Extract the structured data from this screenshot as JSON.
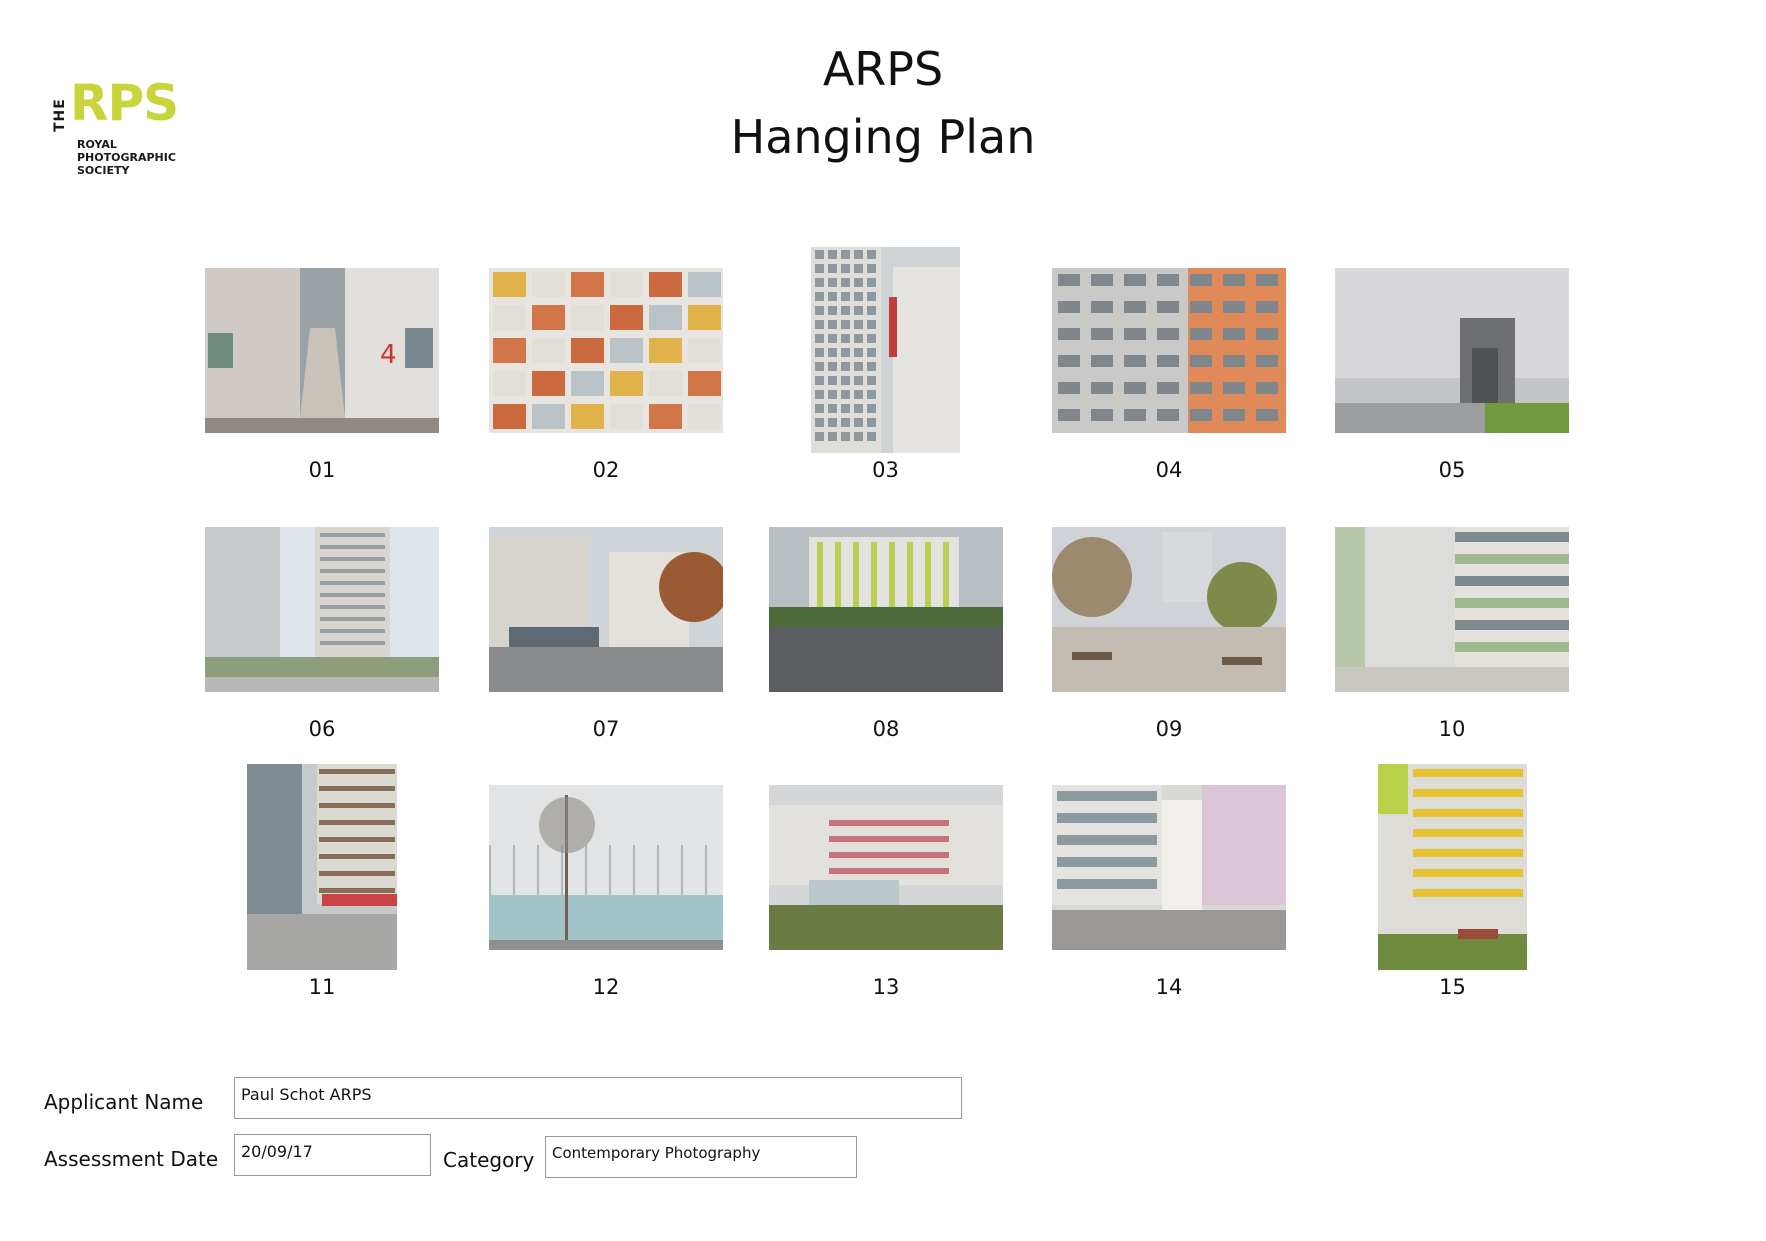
{
  "logo": {
    "the": "THE",
    "rps": "RPS",
    "line1": "ROYAL",
    "line2": "PHOTOGRAPHIC",
    "line3": "SOCIETY",
    "color": "#c8d43a"
  },
  "title": {
    "line1": "ARPS",
    "line2": "Hanging Plan"
  },
  "photos": [
    {
      "label": "01",
      "orientation": "landscape"
    },
    {
      "label": "02",
      "orientation": "landscape"
    },
    {
      "label": "03",
      "orientation": "portrait"
    },
    {
      "label": "04",
      "orientation": "landscape"
    },
    {
      "label": "05",
      "orientation": "landscape"
    },
    {
      "label": "06",
      "orientation": "landscape"
    },
    {
      "label": "07",
      "orientation": "landscape"
    },
    {
      "label": "08",
      "orientation": "landscape"
    },
    {
      "label": "09",
      "orientation": "landscape"
    },
    {
      "label": "10",
      "orientation": "landscape"
    },
    {
      "label": "11",
      "orientation": "portrait"
    },
    {
      "label": "12",
      "orientation": "landscape"
    },
    {
      "label": "13",
      "orientation": "landscape"
    },
    {
      "label": "14",
      "orientation": "landscape"
    },
    {
      "label": "15",
      "orientation": "portrait"
    }
  ],
  "form": {
    "applicant_label": "Applicant Name",
    "applicant_value": "Paul Schot ARPS",
    "date_label": "Assessment Date",
    "date_value": "20/09/17",
    "category_label": "Category",
    "category_value": "Contemporary Photography"
  }
}
